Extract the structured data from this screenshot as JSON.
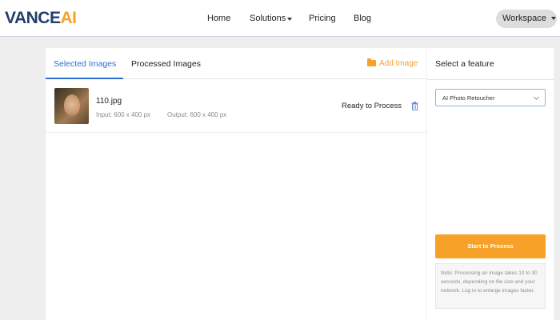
{
  "header": {
    "logo_main": "VANCE",
    "logo_accent": "AI",
    "nav": {
      "home": "Home",
      "solutions": "Solutions",
      "pricing": "Pricing",
      "blog": "Blog"
    },
    "workspace": "Workspace"
  },
  "tabs": {
    "selected": "Selected Images",
    "processed": "Processed Images",
    "active": "Selected Images"
  },
  "add_image": "Add Image",
  "files": [
    {
      "name": "110.jpg",
      "input": "Input: 600 x 400 px",
      "output": "Output: 600 x 400 px",
      "status": "Ready to Process"
    }
  ],
  "feature_panel": {
    "title": "Select a feature",
    "selected_feature": "AI Photo Retoucher",
    "process_button": "Start to Process",
    "note": "Note: Processing an image takes 10 to 30 seconds, depending on file size and your network. Log in to enlarge images faster."
  },
  "colors": {
    "accent_orange": "#f7a128",
    "brand_navy": "#233f6c",
    "tab_blue": "#2d6fd2"
  }
}
